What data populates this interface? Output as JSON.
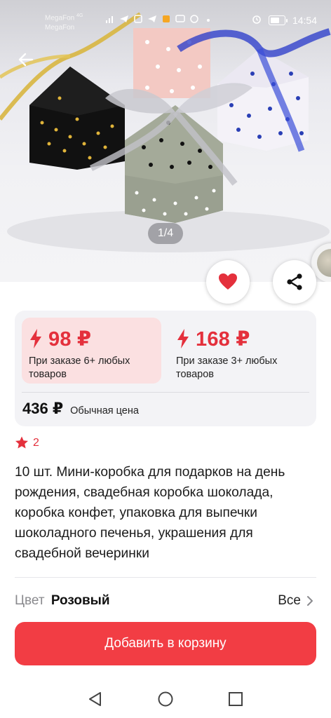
{
  "status_bar": {
    "carrier_1": "MegaFon",
    "carrier_2": "MegaFon",
    "network": "4G",
    "time": "14:54"
  },
  "gallery": {
    "pager": "1/4"
  },
  "price_tiers": [
    {
      "price": "98 ₽",
      "condition": "При заказе 6+ любых товаров",
      "highlighted": true
    },
    {
      "price": "168 ₽",
      "condition": "При заказе 3+ любых товаров",
      "highlighted": false
    }
  ],
  "regular_price": {
    "price": "436 ₽",
    "label": "Обычная цена"
  },
  "rating": {
    "count": "2"
  },
  "product": {
    "title": "10 шт. Мини-коробка для подарков на день рождения, свадебная коробка шоколада, коробка конфет, упаковка для выпечки шоколадного печенья, украшения для свадебной вечеринки"
  },
  "variant": {
    "label": "Цвет",
    "value": "Розовый",
    "all_label": "Все"
  },
  "cart_button": {
    "label": "Добавить в корзину"
  },
  "icons": {
    "back": "arrow-left-icon",
    "favorite": "heart-icon",
    "share": "share-icon",
    "star": "star-icon",
    "lightning": "lightning-icon",
    "chevron": "chevron-right-icon"
  },
  "colors": {
    "accent": "#f23d44",
    "price_red": "#e4303c",
    "tier_highlight": "#fbe0e1",
    "card_bg": "#f3f3f6"
  }
}
